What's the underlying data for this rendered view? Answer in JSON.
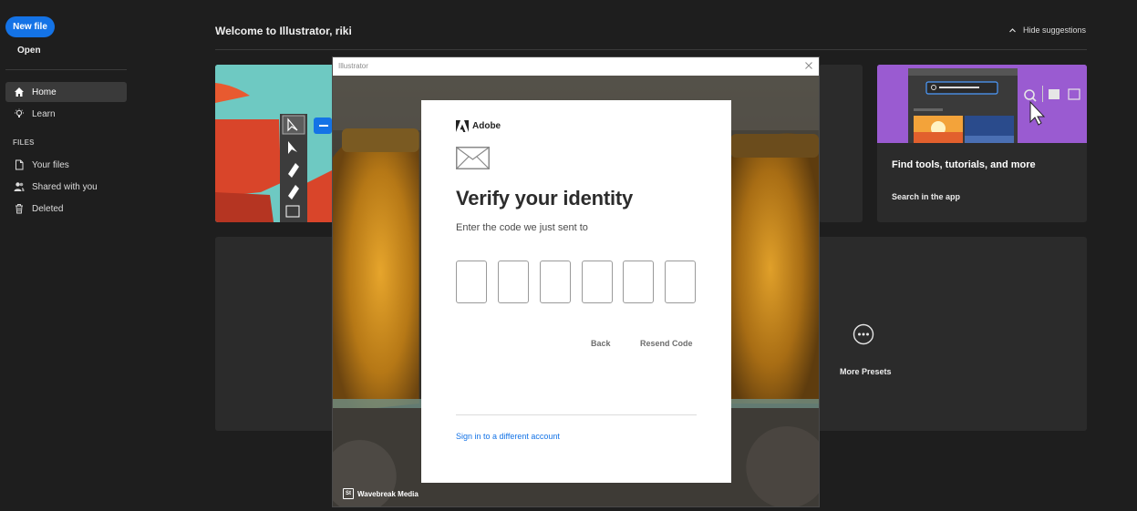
{
  "sidebar": {
    "new_file": "New file",
    "open": "Open",
    "nav": [
      {
        "label": "Home",
        "icon": "home-icon"
      },
      {
        "label": "Learn",
        "icon": "lightbulb-icon"
      }
    ],
    "files_heading": "FILES",
    "files": [
      {
        "label": "Your files",
        "icon": "document-icon"
      },
      {
        "label": "Shared with you",
        "icon": "people-icon"
      },
      {
        "label": "Deleted",
        "icon": "trash-icon"
      }
    ]
  },
  "main": {
    "welcome": "Welcome to Illustrator, riki",
    "hide_suggestions": "Hide suggestions",
    "suggestion_card": {
      "title": "Find tools, tutorials, and more",
      "link": "Search in the app"
    },
    "more_presets": "More Presets"
  },
  "dialog": {
    "window_title": "Illustrator",
    "brand": "Adobe",
    "heading": "Verify your identity",
    "subtext": "Enter the code we just sent to",
    "code_digits": [
      "",
      "",
      "",
      "",
      "",
      ""
    ],
    "back": "Back",
    "resend": "Resend Code",
    "different_account": "Sign in to a different account",
    "credit_badge": "St",
    "credit": "Wavebreak Media"
  },
  "colors": {
    "accent": "#1473e6",
    "background": "#1e1e1e",
    "card": "#2b2b2b"
  }
}
